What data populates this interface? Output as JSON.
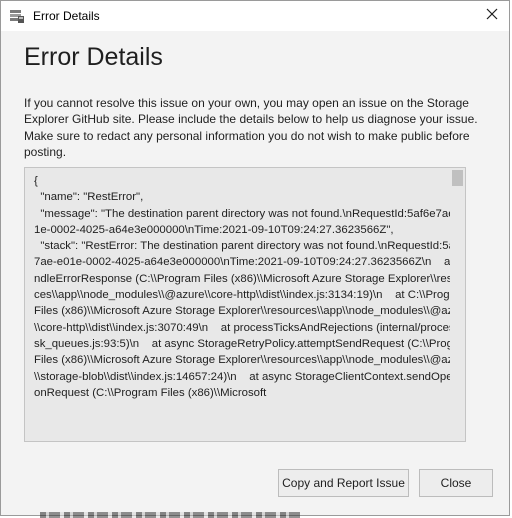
{
  "window": {
    "title": "Error Details",
    "icon": "storage-explorer-app-icon",
    "close_icon": "close-icon"
  },
  "dialog": {
    "heading": "Error Details",
    "description": "If you cannot resolve this issue on your own, you may open an issue on the Storage Explorer GitHub site. Please include the details below to help us diagnose your issue. Make sure to redact any personal information you do not wish to make public before posting.",
    "details": "{\n  \"name\": \"RestError\",\n  \"message\": \"The destination parent directory was not found.\\nRequestId:5af6e7ae-e01e-0002-4025-a64e3e000000\\nTime:2021-09-10T09:24:27.3623566Z\",\n  \"stack\": \"RestError: The destination parent directory was not found.\\nRequestId:5af6e7ae-e01e-0002-4025-a64e3e000000\\nTime:2021-09-10T09:24:27.3623566Z\\n    at handleErrorResponse (C:\\\\Program Files (x86)\\\\Microsoft Azure Storage Explorer\\\\resources\\\\app\\\\node_modules\\\\@azure\\\\core-http\\\\dist\\\\index.js:3134:19)\\n    at C:\\\\Program Files (x86)\\\\Microsoft Azure Storage Explorer\\\\resources\\\\app\\\\node_modules\\\\@azure\\\\core-http\\\\dist\\\\index.js:3070:49\\n    at processTicksAndRejections (internal/process/task_queues.js:93:5)\\n    at async StorageRetryPolicy.attemptSendRequest (C:\\\\Program Files (x86)\\\\Microsoft Azure Storage Explorer\\\\resources\\\\app\\\\node_modules\\\\@azure\\\\storage-blob\\\\dist\\\\index.js:14657:24)\\n    at async StorageClientContext.sendOperationRequest (C:\\\\Program Files (x86)\\\\Microsoft"
  },
  "buttons": {
    "report_label": "Copy and Report Issue",
    "close_label": "Close"
  }
}
